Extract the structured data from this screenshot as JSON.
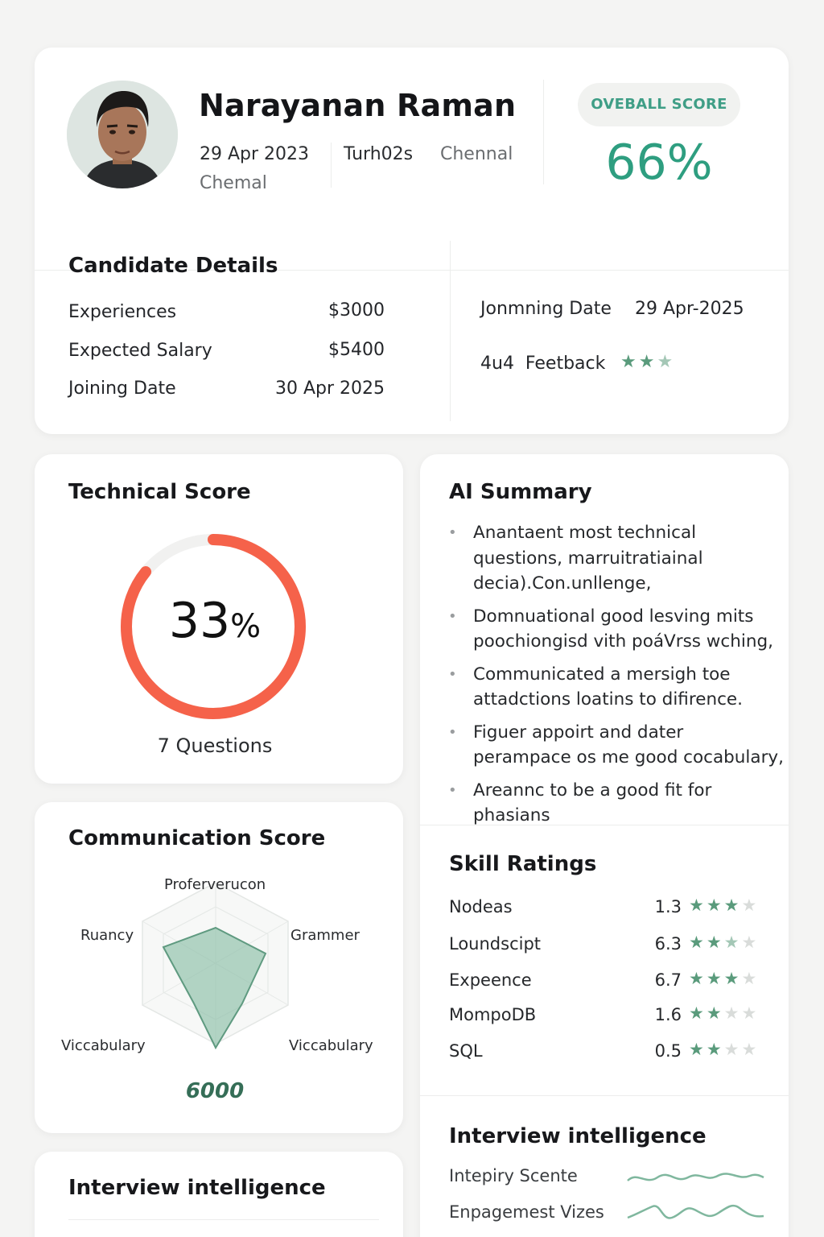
{
  "header": {
    "name": "Narayanan Raman",
    "date": "29 Apr 2023",
    "location_secondary": "Chemal",
    "id_code": "Turh02s",
    "city": "Chennal",
    "score_label": "OVEBALL SCORE",
    "score_value": "66%"
  },
  "candidate_details": {
    "title": "Candidate Details",
    "rows": [
      {
        "label": "Experiences",
        "value": "$3000"
      },
      {
        "label": "Expected Salary",
        "value": "$5400"
      },
      {
        "label": "Joining Date",
        "value": "30 Apr 2025"
      }
    ],
    "joining_label": "Jonmning Date",
    "joining_value": "29 Apr-2025",
    "feedback_label": "4u4  Feetback",
    "feedback_rating": 2.5
  },
  "technical": {
    "title": "Technical Score",
    "percent_number": "33",
    "percent_sign": "%",
    "percent_value": 0.33,
    "questions": "7 Questions",
    "ring_color": "#f5624a"
  },
  "communication": {
    "title": "Communication Score",
    "labels": [
      "Proferverucon",
      "Grammer",
      "Viccabulary",
      "Viccabulary",
      "Ruancy"
    ],
    "value": "6000",
    "fill_color": "#8cbfa7"
  },
  "summary": {
    "title": "AI Summary",
    "items": [
      "Anantaent most technical questions, marruitratiainal decia).Con.unllenge,",
      "Domnuational good lesving mits poochiongisd  vith poáVrss wching,",
      "Communicated a mersigh toe attadctions loatins to difirence.",
      "Figuer appoirt and dater perampace os me good cocabulary,",
      "Areannc to be a good fit for phasians"
    ]
  },
  "skills": {
    "title": "Skill Ratings",
    "items": [
      {
        "name": "Nodeas",
        "score": "1.3",
        "stars": 3
      },
      {
        "name": "Loundscipt",
        "score": "6.3",
        "stars": 2.5
      },
      {
        "name": "Expeence",
        "score": "6.7",
        "stars": 3
      },
      {
        "name": "MompoDB",
        "score": "1.6",
        "stars": 2
      },
      {
        "name": "SQL",
        "score": "0.5",
        "stars": 2
      }
    ]
  },
  "intelligence": {
    "title": "Interview intelligence",
    "metrics": [
      "Intepiry Scente",
      "Enpagemest Vizes"
    ],
    "wave_color": "#7fb79e"
  },
  "colors": {
    "accent": "#2e9e80",
    "star": "#5a9b7c"
  }
}
